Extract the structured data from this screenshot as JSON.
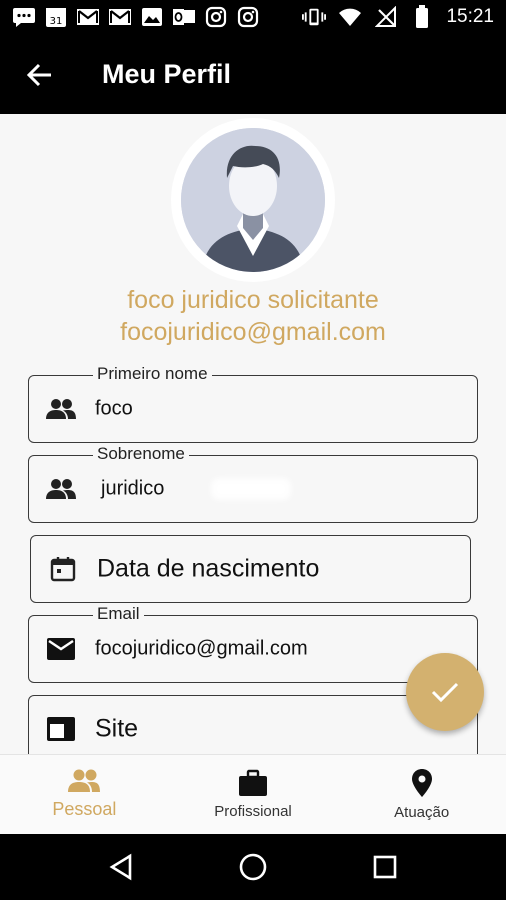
{
  "status_bar": {
    "time": "15:21",
    "left_icons": [
      "message-icon",
      "calendar-icon",
      "gmail-icon",
      "gmail-icon",
      "image-icon",
      "outlook-icon",
      "instagram-icon",
      "instagram-icon"
    ],
    "calendar_day": "31",
    "right_icons": [
      "vibrate-icon",
      "wifi-icon",
      "no-signal-icon",
      "battery-icon"
    ]
  },
  "app_bar": {
    "title": "Meu Perfil"
  },
  "profile": {
    "name": "foco juridico solicitante",
    "email": "focojuridico@gmail.com"
  },
  "fields": [
    {
      "label": "Primeiro nome",
      "value": "foco",
      "icon": "people-icon"
    },
    {
      "label": "Sobrenome",
      "value": "juridico",
      "icon": "people-icon"
    },
    {
      "label": "",
      "placeholder": "Data de nascimento",
      "icon": "calendar-icon"
    },
    {
      "label": "Email",
      "value": "focojuridico@gmail.com",
      "icon": "mail-icon"
    },
    {
      "label": "",
      "placeholder": "Site",
      "icon": "web-icon"
    }
  ],
  "bottom_nav": [
    {
      "label": "Pessoal",
      "icon": "people-icon",
      "active": true
    },
    {
      "label": "Profissional",
      "icon": "briefcase-icon",
      "active": false
    },
    {
      "label": "Atuação",
      "icon": "location-pin-icon",
      "active": false
    }
  ],
  "colors": {
    "accent": "#d0a860",
    "fab": "#d3b16f",
    "app_bar": "#000000",
    "background": "#f7f7f7"
  }
}
